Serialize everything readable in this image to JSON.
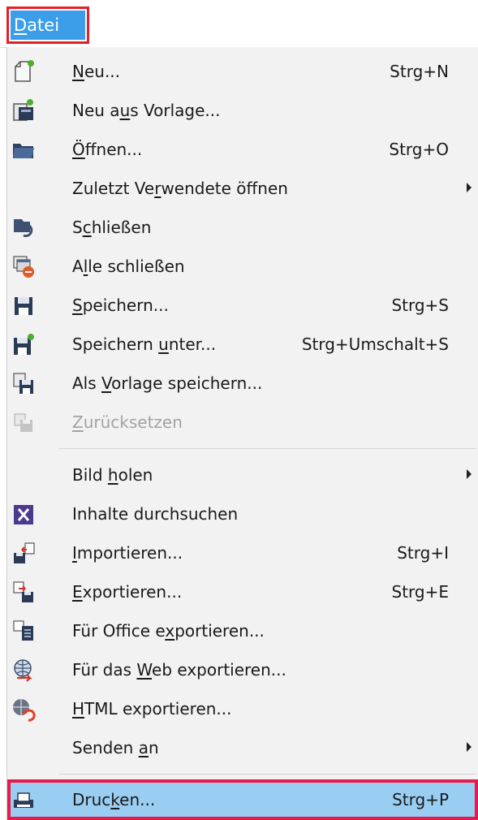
{
  "menubar": {
    "label_pre": "",
    "label_u": "D",
    "label_post": "atei",
    "highlight_color": "#e0202a",
    "selected_bg": "#3c9ee8"
  },
  "menu": {
    "items": [
      {
        "icon": "new-document-icon",
        "pre": "",
        "u": "N",
        "post": "eu...",
        "shortcut": "Strg+N"
      },
      {
        "icon": "new-from-template-icon",
        "pre": "Neu a",
        "u": "u",
        "post": "s Vorlage...",
        "shortcut": ""
      },
      {
        "icon": "open-folder-icon",
        "pre": "",
        "u": "Ö",
        "post": "ffnen...",
        "shortcut": "Strg+O"
      },
      {
        "icon": "",
        "pre": "Zuletzt Ve",
        "u": "r",
        "post": "wendete öffnen",
        "shortcut": ""
      },
      {
        "icon": "close-document-icon",
        "pre": "S",
        "u": "c",
        "post": "hließen",
        "shortcut": ""
      },
      {
        "icon": "close-all-icon",
        "pre": "A",
        "u": "l",
        "post": "le schließen",
        "shortcut": ""
      },
      {
        "icon": "save-icon",
        "pre": "",
        "u": "S",
        "post": "peichern...",
        "shortcut": "Strg+S"
      },
      {
        "icon": "save-as-icon",
        "pre": "Speichern ",
        "u": "u",
        "post": "nter...",
        "shortcut": "Strg+Umschalt+S"
      },
      {
        "icon": "save-as-template-icon",
        "pre": "Als ",
        "u": "V",
        "post": "orlage speichern...",
        "shortcut": ""
      },
      {
        "icon": "revert-icon",
        "pre": "",
        "u": "Z",
        "post": "urücksetzen",
        "shortcut": ""
      },
      {
        "icon": "",
        "pre": "Bild ",
        "u": "h",
        "post": "olen",
        "shortcut": ""
      },
      {
        "icon": "search-content-icon",
        "pre": "Inhalte durchsuchen",
        "u": "",
        "post": "",
        "shortcut": ""
      },
      {
        "icon": "import-icon",
        "pre": "",
        "u": "I",
        "post": "mportieren...",
        "shortcut": "Strg+I"
      },
      {
        "icon": "export-icon",
        "pre": "",
        "u": "E",
        "post": "xportieren...",
        "shortcut": "Strg+E"
      },
      {
        "icon": "export-office-icon",
        "pre": "Für Office e",
        "u": "x",
        "post": "portieren...",
        "shortcut": ""
      },
      {
        "icon": "export-web-icon",
        "pre": "Für das ",
        "u": "W",
        "post": "eb exportieren...",
        "shortcut": ""
      },
      {
        "icon": "html-export-icon",
        "pre": "",
        "u": "H",
        "post": "TML exportieren...",
        "shortcut": ""
      },
      {
        "icon": "",
        "pre": "Senden ",
        "u": "a",
        "post": "n",
        "shortcut": ""
      },
      {
        "icon": "printer-icon",
        "pre": "Druc",
        "u": "k",
        "post": "en...",
        "shortcut": "Strg+P"
      }
    ],
    "highlight_color": "#e8194b",
    "hover_bg": "#99cdf2"
  }
}
